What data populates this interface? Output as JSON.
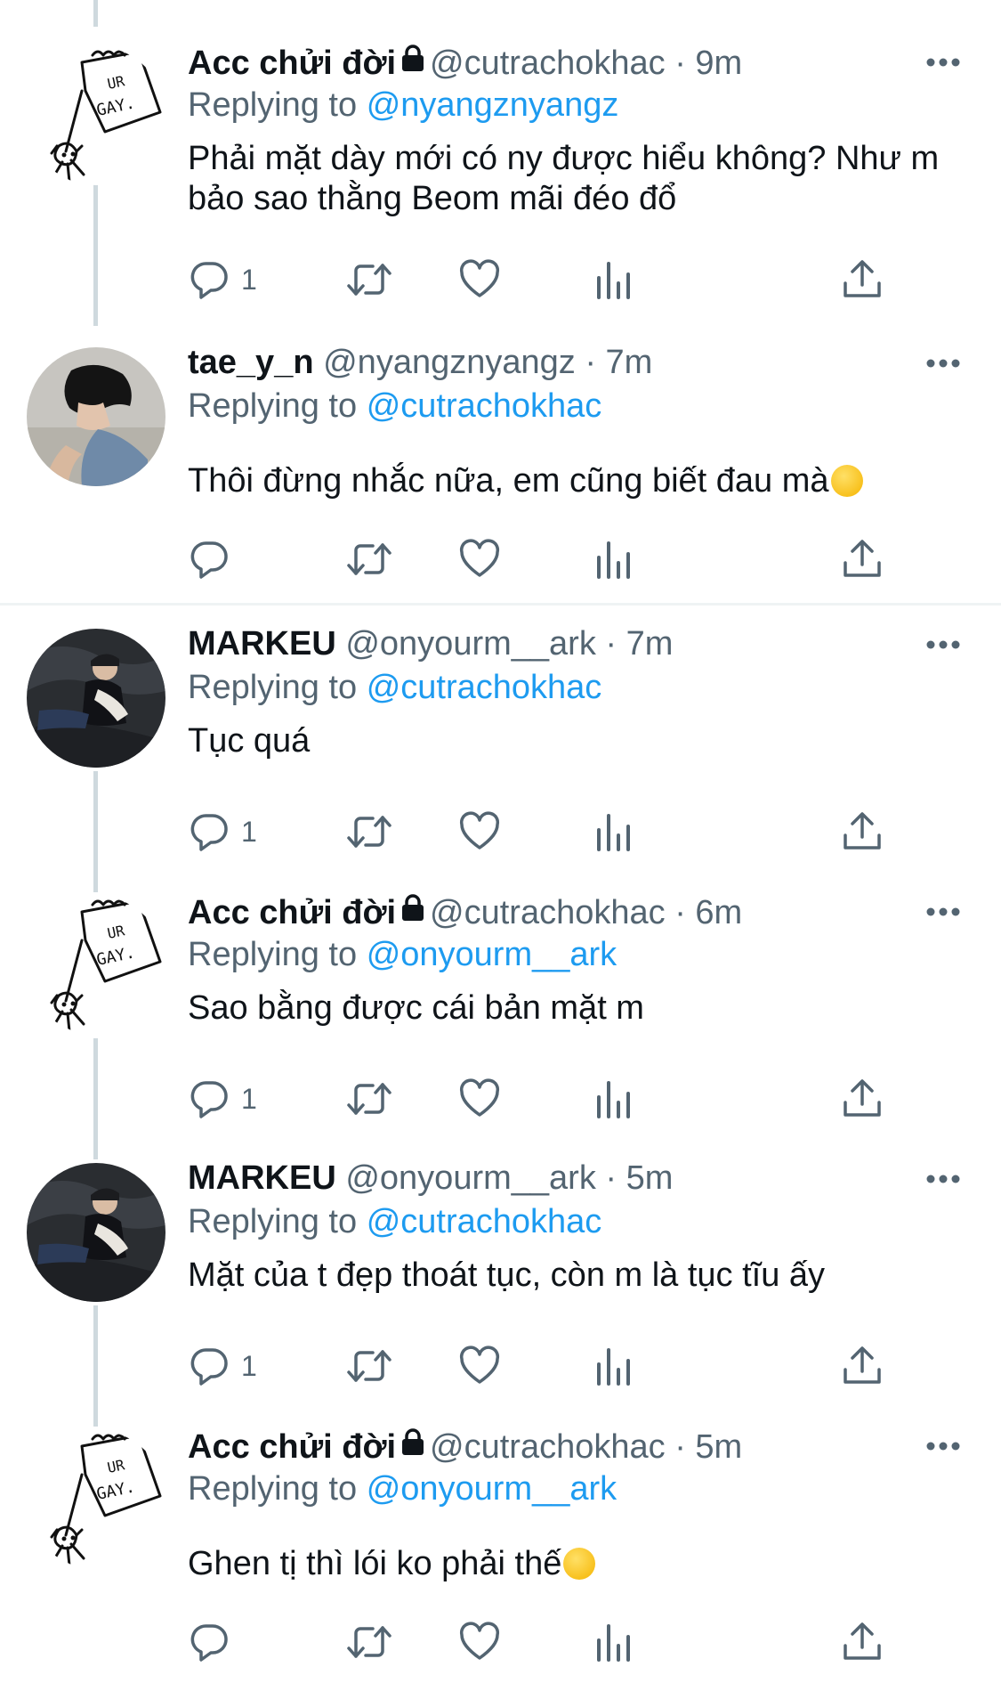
{
  "tweets": [
    {
      "name": "Acc chửi đời",
      "protected": true,
      "handle": "@cutrachokhac",
      "time": "9m",
      "replying_label": "Replying to",
      "replying_to": "@nyangznyangz",
      "text": "Phải mặt dày mới có ny được hiểu không? Như m bảo sao thằng Beom mãi đéo đổ",
      "reply_count": "1",
      "avatar": "ur-gay-sketch"
    },
    {
      "name": "tae_y_n",
      "protected": false,
      "handle": "@nyangznyangz",
      "time": "7m",
      "replying_label": "Replying to",
      "replying_to": "@cutrachokhac",
      "text": "Thôi đừng nhắc nữa, em cũng biết đau mà",
      "emoji": "crying-face",
      "reply_count": "",
      "avatar": "photo-boy-profile"
    },
    {
      "name": "MARKEU",
      "protected": false,
      "handle": "@onyourm__ark",
      "time": "7m",
      "replying_label": "Replying to",
      "replying_to": "@cutrachokhac",
      "text": "Tục quá",
      "reply_count": "1",
      "avatar": "photo-seated-man"
    },
    {
      "name": "Acc chửi đời",
      "protected": true,
      "handle": "@cutrachokhac",
      "time": "6m",
      "replying_label": "Replying to",
      "replying_to": "@onyourm__ark",
      "text": "Sao bằng được cái bản mặt m",
      "reply_count": "1",
      "avatar": "ur-gay-sketch"
    },
    {
      "name": "MARKEU",
      "protected": false,
      "handle": "@onyourm__ark",
      "time": "5m",
      "replying_label": "Replying to",
      "replying_to": "@cutrachokhac",
      "text": "Mặt của t đẹp thoát tục, còn m là tục tĩu ấy",
      "reply_count": "1",
      "avatar": "photo-seated-man"
    },
    {
      "name": "Acc chửi đời",
      "protected": true,
      "handle": "@cutrachokhac",
      "time": "5m",
      "replying_label": "Replying to",
      "replying_to": "@onyourm__ark",
      "text": "Ghen tị thì lói ko phải thế",
      "emoji": "smirking-face",
      "reply_count": "",
      "avatar": "ur-gay-sketch"
    }
  ],
  "sketch_avatar_text": [
    "UR",
    "GAY."
  ],
  "separator": "·",
  "icons": {
    "reply": "reply-bubble-icon",
    "retweet": "retweet-icon",
    "like": "heart-icon",
    "views": "views-bars-icon",
    "share": "share-upload-icon",
    "more": "more-dots-icon",
    "lock": "lock-icon"
  },
  "colors": {
    "link": "#1d9bf0",
    "secondary_text": "#536471",
    "primary_text": "#0f1419",
    "thread_line": "#cfd9de",
    "divider": "#eff3f4"
  }
}
